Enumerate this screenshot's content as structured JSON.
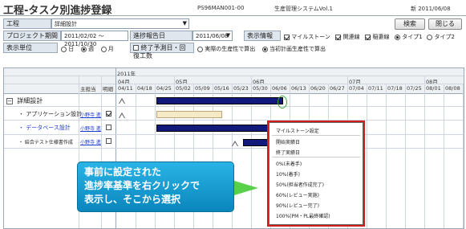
{
  "header": {
    "title": "工程-タスク別進捗登録",
    "program_id": "PS96MAN001-00",
    "system_name": "生産管理システムVol.1",
    "date": "新 2011/06/08"
  },
  "filters": {
    "process_label": "工程",
    "process_value": "詳細設計",
    "project_period_label": "プロジェクト期間",
    "project_period_value": "2011/02/02 ～ 2011/10/30",
    "progress_report_date_label": "進捗報告日",
    "progress_report_date_value": "2011/06/08",
    "display_info_label": "表示情報",
    "display_unit_label": "表示単位",
    "search_button": "検索",
    "close_button": "閉じる"
  },
  "display_info_options": [
    {
      "label": "マイルストーン",
      "checked": true
    },
    {
      "label": "関連線",
      "checked": true
    },
    {
      "label": "稲妻線",
      "checked": true
    },
    {
      "label": "タイプ1",
      "checked": true
    },
    {
      "label": "タイプ2",
      "checked": false
    }
  ],
  "display_unit_options": [
    {
      "label": "日",
      "checked": false
    },
    {
      "label": "週",
      "checked": true
    },
    {
      "label": "月",
      "checked": false
    }
  ],
  "calc_options": [
    {
      "label": "終了予測日・回復工数",
      "checked": false
    },
    {
      "label": "実際の生産性で算出",
      "checked": false
    },
    {
      "label": "当初計画生産性で算出",
      "checked": true
    }
  ],
  "gantt": {
    "year": "2011年",
    "months": [
      "04月",
      "05月",
      "06月",
      "07月",
      "08月"
    ],
    "col_headers": [
      "主担当",
      "明細"
    ],
    "weeks": [
      "04/11",
      "04/18",
      "04/25",
      "05/02",
      "05/09",
      "05/16",
      "05/23",
      "05/30",
      "06/06",
      "06/13",
      "06/20",
      "06/27",
      "07/04",
      "07/11",
      "07/18",
      "07/25",
      "08/01",
      "08/08"
    ],
    "rows": [
      {
        "name": "詳細設計",
        "owner": "",
        "detail": false
      },
      {
        "name": "アプリケーション設計",
        "owner": "小野寺 進",
        "detail": true
      },
      {
        "name": "データベース設計",
        "owner": "小野寺 進",
        "detail": false
      },
      {
        "name": "結合テスト仕様書作成",
        "owner": "小野寺 進",
        "detail": false
      }
    ],
    "expand_icon": "minus-box"
  },
  "context_menu": {
    "items": [
      "マイルストーン設定",
      "開始実績日",
      "終了実績日",
      "0%(未着手)",
      "10%(着手)",
      "50%(担当者作成完了)",
      "60%(レビュー実施)",
      "90%(レビュー完了)",
      "100%(PM・PL最終確認)"
    ]
  },
  "callout": {
    "line1": "事前に設定された",
    "line2": "進捗率基準を右クリックで",
    "line3": "表示し、そこから選択"
  },
  "colors": {
    "bar": "#111a7a",
    "highlight": "#d21d1d",
    "callout": "#0a86bd",
    "arrow": "#58d04a"
  }
}
